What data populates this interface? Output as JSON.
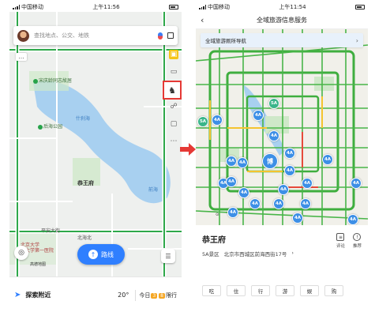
{
  "left_phone": {
    "status": {
      "carrier": "中国移动",
      "time": "上午11:56"
    },
    "search": {
      "placeholder": "查找地点、公交、地铁"
    },
    "map_labels": {
      "arts": "宋庆龄同志故居",
      "park": "后海公园",
      "lotus": "什刹海",
      "gongwangfu": "恭王府",
      "qianhai": "前海",
      "ping_an": "平安大街",
      "beihai_north": "北海北",
      "hospital": "北京大学第一医院",
      "dongwangzhuang": "北京大学"
    },
    "logo": "高德地图",
    "route_button": "路线",
    "bottom": {
      "explore": "探索附近",
      "temperature": "20°",
      "today": "今日",
      "plates": [
        "3",
        "8"
      ],
      "limit": "限行"
    }
  },
  "right_phone": {
    "status": {
      "carrier": "中国移动",
      "time": "上午11:54"
    },
    "title": "全域旅游信息服务",
    "guide_bar": "全域旅游厕所导航",
    "marker_label": "4A",
    "marker_labels": {
      "five_a": "5A",
      "bo": "博"
    },
    "poi": {
      "name": "恭王府",
      "level": "5A景区",
      "address": "北京市西城区前海西街17号",
      "actions": [
        {
          "label": "评论",
          "icon": "comment-icon"
        },
        {
          "label": "推荐",
          "icon": "recommend-icon"
        }
      ],
      "categories": [
        "吃",
        "住",
        "行",
        "游",
        "娱",
        "购"
      ]
    }
  },
  "colors": {
    "accent": "#2f7fff",
    "highlight": "#e53935",
    "marker": "#3d8fe6",
    "traffic_green": "#3fae3f"
  }
}
